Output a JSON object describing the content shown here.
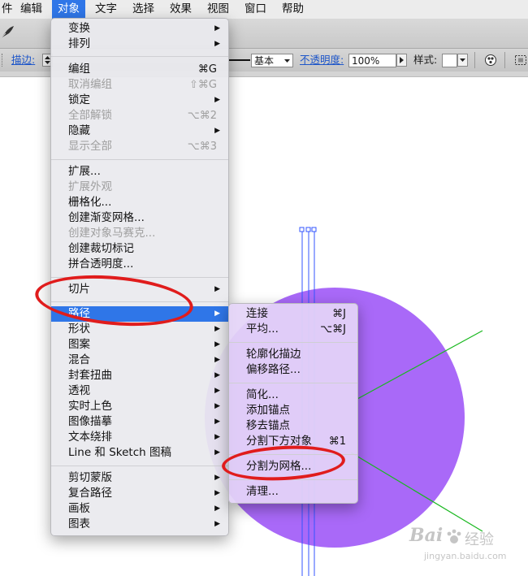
{
  "menubar": {
    "items": [
      "件",
      "编辑",
      "对象",
      "文字",
      "选择",
      "效果",
      "视图",
      "窗口",
      "帮助"
    ],
    "active_index": 2
  },
  "toolbar": {
    "stroke_label": "描边:",
    "stroke_style": "基本",
    "opacity_label": "不透明度:",
    "opacity_value": "100%",
    "style_label": "样式:"
  },
  "object_menu": {
    "groups": [
      [
        {
          "label": "变换",
          "submenu": true
        },
        {
          "label": "排列",
          "submenu": true
        }
      ],
      [
        {
          "label": "编组",
          "shortcut": "⌘G"
        },
        {
          "label": "取消编组",
          "shortcut": "⇧⌘G",
          "disabled": true
        },
        {
          "label": "锁定",
          "submenu": true
        },
        {
          "label": "全部解锁",
          "shortcut": "⌥⌘2",
          "disabled": true
        },
        {
          "label": "隐藏",
          "submenu": true
        },
        {
          "label": "显示全部",
          "shortcut": "⌥⌘3",
          "disabled": true
        }
      ],
      [
        {
          "label": "扩展..."
        },
        {
          "label": "扩展外观",
          "disabled": true
        },
        {
          "label": "栅格化..."
        },
        {
          "label": "创建渐变网格..."
        },
        {
          "label": "创建对象马赛克...",
          "disabled": true
        },
        {
          "label": "创建裁切标记"
        },
        {
          "label": "拼合透明度..."
        }
      ],
      [
        {
          "label": "切片",
          "submenu": true
        }
      ],
      [
        {
          "label": "路径",
          "submenu": true,
          "highlighted": true
        },
        {
          "label": "形状",
          "submenu": true
        },
        {
          "label": "图案",
          "submenu": true
        },
        {
          "label": "混合",
          "submenu": true
        },
        {
          "label": "封套扭曲",
          "submenu": true
        },
        {
          "label": "透视",
          "submenu": true
        },
        {
          "label": "实时上色",
          "submenu": true
        },
        {
          "label": "图像描摹",
          "submenu": true
        },
        {
          "label": "文本绕排",
          "submenu": true
        },
        {
          "label": "Line 和 Sketch 图稿",
          "submenu": true
        }
      ],
      [
        {
          "label": "剪切蒙版",
          "submenu": true
        },
        {
          "label": "复合路径",
          "submenu": true
        },
        {
          "label": "画板",
          "submenu": true
        },
        {
          "label": "图表",
          "submenu": true
        }
      ]
    ]
  },
  "path_submenu": {
    "groups": [
      [
        {
          "label": "连接",
          "shortcut": "⌘J"
        },
        {
          "label": "平均...",
          "shortcut": "⌥⌘J"
        }
      ],
      [
        {
          "label": "轮廓化描边"
        },
        {
          "label": "偏移路径..."
        }
      ],
      [
        {
          "label": "简化..."
        },
        {
          "label": "添加锚点"
        },
        {
          "label": "移去锚点"
        },
        {
          "label": "分割下方对象",
          "shortcut": "⌘1"
        }
      ],
      [
        {
          "label": "分割为网格..."
        }
      ],
      [
        {
          "label": "清理..."
        }
      ]
    ]
  },
  "watermark": {
    "brand": "Bai",
    "brand_tail": "经验",
    "url": "jingyan.baidu.com"
  },
  "colors": {
    "accent": "#2f76e8",
    "circle": "#a969f8",
    "annotation": "#e01c1c",
    "guide": "#3355ff",
    "line": "#19b81f"
  }
}
